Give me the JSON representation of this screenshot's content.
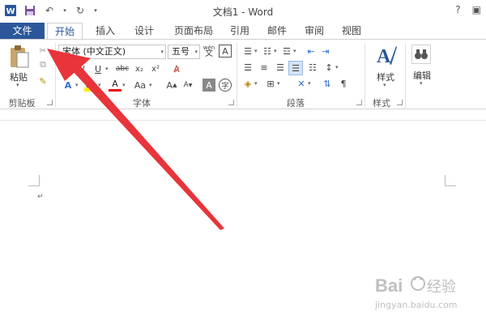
{
  "app": {
    "title": "文档1 - Word",
    "help": "?",
    "accent": "#2b579a"
  },
  "tabs": [
    {
      "label": "文件"
    },
    {
      "label": "开始"
    },
    {
      "label": "插入"
    },
    {
      "label": "设计"
    },
    {
      "label": "页面布局"
    },
    {
      "label": "引用"
    },
    {
      "label": "邮件"
    },
    {
      "label": "审阅"
    },
    {
      "label": "视图"
    }
  ],
  "ribbon": {
    "clipboard": {
      "label": "剪贴板",
      "paste": "粘贴"
    },
    "font": {
      "label": "字体",
      "name": "宋体 (中文正文)",
      "size": "五号",
      "wen": "wén"
    },
    "paragraph": {
      "label": "段落"
    },
    "styles": {
      "label": "样式",
      "button": "样式"
    },
    "editing": {
      "label": "编辑"
    }
  },
  "watermark": {
    "brand": "Bai",
    "brand2": "经验",
    "url": "jingyan.baidu.com"
  },
  "arrow_color": "#e8343a"
}
